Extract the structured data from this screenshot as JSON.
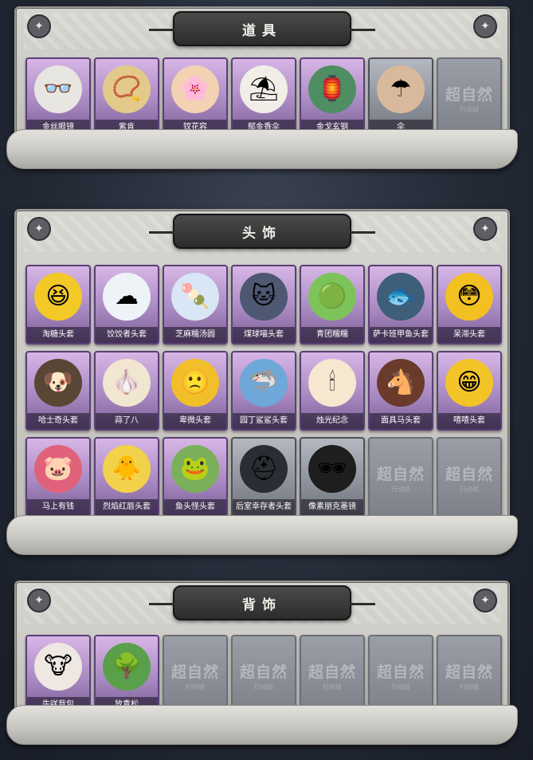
{
  "sections": [
    {
      "title": "道具",
      "items": [
        {
          "label": "金丝眼镜",
          "icon": "glasses-icon",
          "glyph": "👓",
          "bg": "#e8e6e0",
          "style": "purple"
        },
        {
          "label": "紫肯",
          "icon": "pendant-icon",
          "glyph": "📿",
          "bg": "#e3c98a",
          "style": "purple"
        },
        {
          "label": "钗花容",
          "icon": "hairpin-icon",
          "glyph": "🌸",
          "bg": "#f3d2b4",
          "style": "purple"
        },
        {
          "label": "郁金香伞",
          "icon": "parasol-icon",
          "glyph": "⛱",
          "bg": "#f1eee8",
          "style": "purple"
        },
        {
          "label": "金戈玄钢",
          "icon": "lantern-icon",
          "glyph": "🏮",
          "bg": "#4f8d63",
          "style": "purple"
        },
        {
          "label": "伞",
          "icon": "umbrella-icon",
          "glyph": "☂",
          "bg": "#d9b99b",
          "style": "gray"
        },
        {
          "label": "",
          "icon": "",
          "glyph": "",
          "bg": "",
          "style": "empty"
        }
      ]
    },
    {
      "title": "头饰",
      "items": [
        {
          "label": "淘糖头套",
          "icon": "laughing-face-icon",
          "glyph": "😆",
          "bg": "#f3c928",
          "style": "purple"
        },
        {
          "label": "饺饺者头套",
          "icon": "cloud-face-icon",
          "glyph": "☁",
          "bg": "#eef3f7",
          "style": "purple"
        },
        {
          "label": "芝麻糯汤圆",
          "icon": "rice-ball-icon",
          "glyph": "🍡",
          "bg": "#d8e6f5",
          "style": "purple"
        },
        {
          "label": "煤球喵头套",
          "icon": "cat-head-icon",
          "glyph": "🐱",
          "bg": "#4f5872",
          "style": "purple"
        },
        {
          "label": "青团糯糯",
          "icon": "green-ball-icon",
          "glyph": "🟢",
          "bg": "#7cc35a",
          "style": "purple"
        },
        {
          "label": "萨卡班甲鱼头套",
          "icon": "fish-head-icon",
          "glyph": "🐟",
          "bg": "#3e5f7a",
          "style": "purple"
        },
        {
          "label": "呆滞头套",
          "icon": "dazed-face-icon",
          "glyph": "😳",
          "bg": "#f2c021",
          "style": "purple"
        },
        {
          "label": "哈士奇头套",
          "icon": "dog-head-icon",
          "glyph": "🐶",
          "bg": "#5a4634",
          "style": "purple"
        },
        {
          "label": "蒜了八",
          "icon": "garlic-icon",
          "glyph": "🧄",
          "bg": "#f1e6cf",
          "style": "purple"
        },
        {
          "label": "卑微头套",
          "icon": "sad-face-icon",
          "glyph": "🙁",
          "bg": "#f2bf2a",
          "style": "purple"
        },
        {
          "label": "园丁鲨鲨头套",
          "icon": "shark-head-icon",
          "glyph": "🦈",
          "bg": "#6ea8d8",
          "style": "purple"
        },
        {
          "label": "烛光纪念",
          "icon": "candle-icon",
          "glyph": "🕯",
          "bg": "#f5e7d0",
          "style": "purple"
        },
        {
          "label": "面具马头套",
          "icon": "horse-head-icon",
          "glyph": "🐴",
          "bg": "#6a3b2a",
          "style": "purple"
        },
        {
          "label": "嘻嘻头套",
          "icon": "grin-face-icon",
          "glyph": "😁",
          "bg": "#f3c428",
          "style": "purple"
        },
        {
          "label": "马上有钱",
          "icon": "pig-head-icon",
          "glyph": "🐷",
          "bg": "#e0627a",
          "style": "purple"
        },
        {
          "label": "烈焰红唇头套",
          "icon": "pikachu-head-icon",
          "glyph": "🐥",
          "bg": "#f2d24a",
          "style": "purple"
        },
        {
          "label": "鱼头怪头套",
          "icon": "fish-monster-icon",
          "glyph": "🐸",
          "bg": "#7ab05a",
          "style": "purple"
        },
        {
          "label": "后室幸存者头套",
          "icon": "gas-mask-icon",
          "glyph": "⛑",
          "bg": "#2a2d33",
          "style": "gray"
        },
        {
          "label": "像素朋克墨镜",
          "icon": "pixel-sunglasses-icon",
          "glyph": "🕶",
          "bg": "#1e1e1e",
          "style": "gray"
        },
        {
          "label": "",
          "icon": "",
          "glyph": "",
          "bg": "",
          "style": "empty"
        },
        {
          "label": "",
          "icon": "",
          "glyph": "",
          "bg": "",
          "style": "empty"
        }
      ]
    },
    {
      "title": "背饰",
      "items": [
        {
          "label": "牛咩背包",
          "icon": "cow-backpack-icon",
          "glyph": "🐮",
          "bg": "#eee7e2",
          "style": "purple"
        },
        {
          "label": "放青松",
          "icon": "bonsai-tree-icon",
          "glyph": "🌳",
          "bg": "#5aa04a",
          "style": "purple"
        },
        {
          "label": "",
          "icon": "",
          "glyph": "",
          "bg": "",
          "style": "empty"
        },
        {
          "label": "",
          "icon": "",
          "glyph": "",
          "bg": "",
          "style": "empty"
        },
        {
          "label": "",
          "icon": "",
          "glyph": "",
          "bg": "",
          "style": "empty"
        },
        {
          "label": "",
          "icon": "",
          "glyph": "",
          "bg": "",
          "style": "empty"
        },
        {
          "label": "",
          "icon": "",
          "glyph": "",
          "bg": "",
          "style": "empty"
        }
      ]
    }
  ],
  "empty_slot_watermark": "超自然",
  "empty_slot_sub": "行动组",
  "corner_icon": "compass-icon"
}
